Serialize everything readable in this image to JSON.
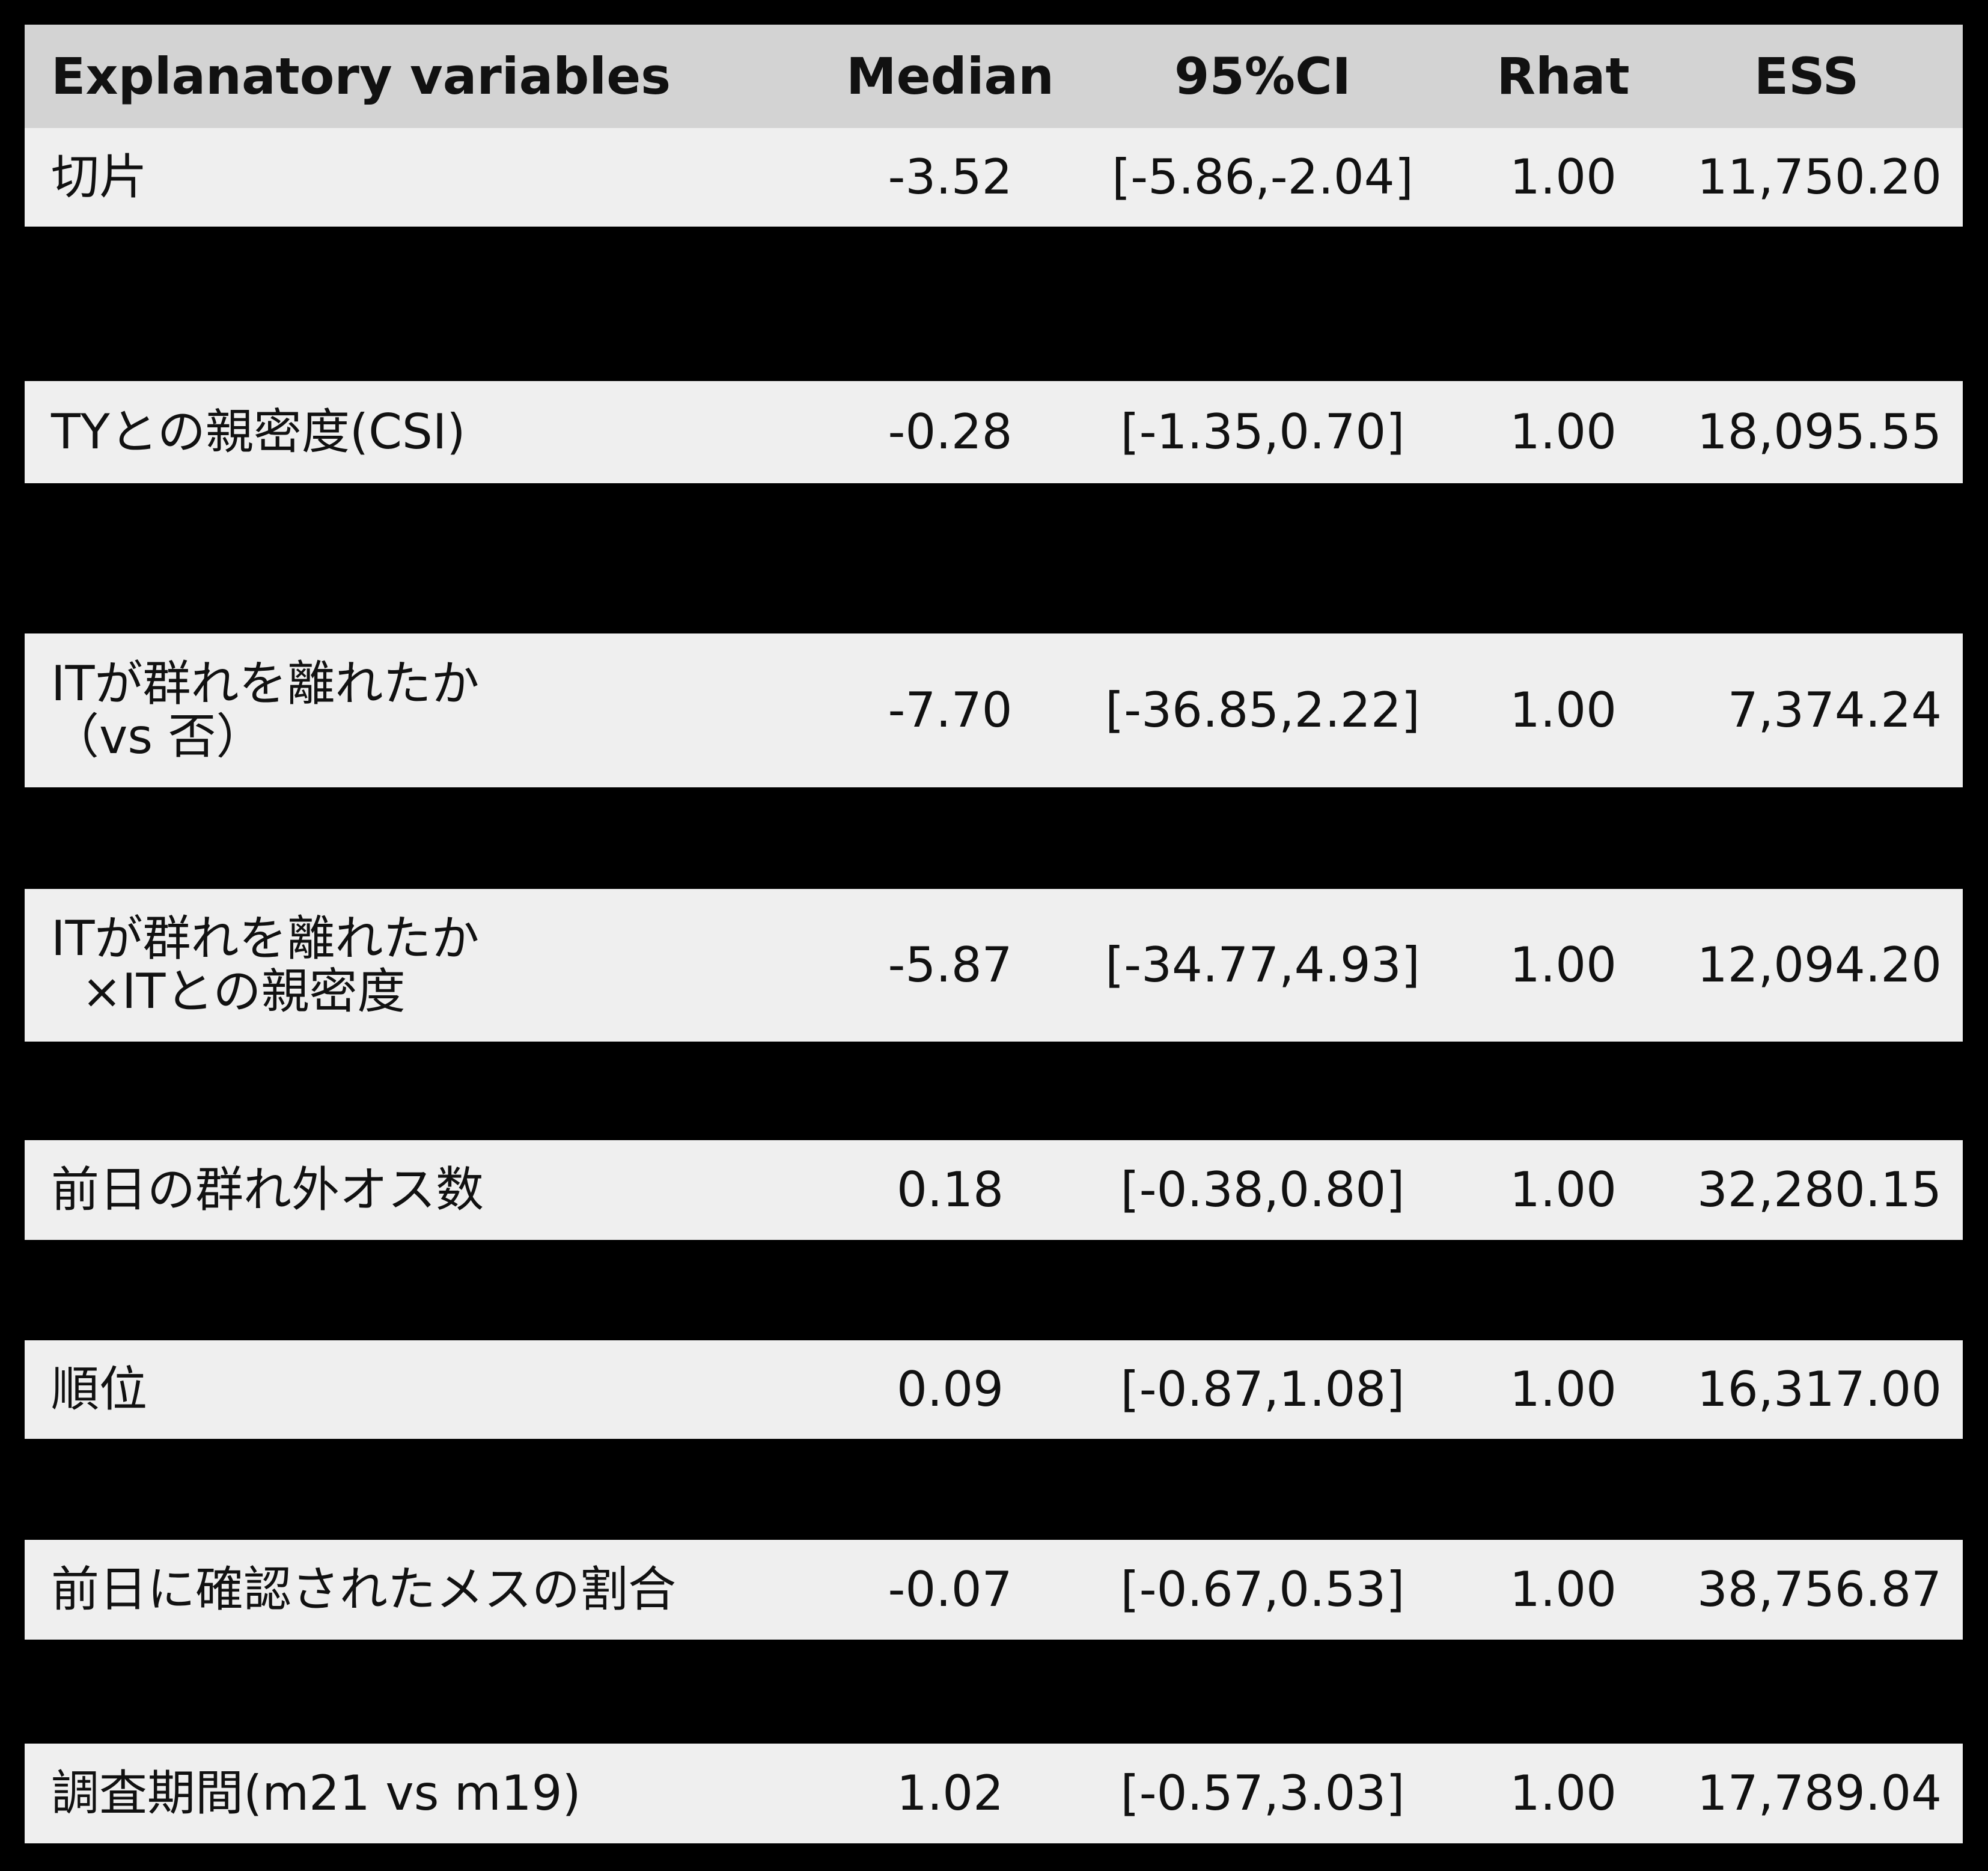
{
  "header": {
    "variable": "Explanatory variables",
    "median": "Median",
    "ci": "95%CI",
    "rhat": "Rhat",
    "ess": "ESS"
  },
  "rows": [
    {
      "variable": [
        "切片"
      ],
      "median": "-3.52",
      "ci": "[-5.86,-2.04]",
      "rhat": "1.00",
      "ess": "11,750.20"
    },
    {
      "variable": [
        "TYとの親密度(CSI)"
      ],
      "median": "-0.28",
      "ci": "[-1.35,0.70]",
      "rhat": "1.00",
      "ess": "18,095.55"
    },
    {
      "variable": [
        "ITが群れを離れたか",
        "（vs 否）"
      ],
      "median": "-7.70",
      "ci": "[-36.85,2.22]",
      "rhat": "1.00",
      "ess": "7,374.24"
    },
    {
      "variable": [
        "ITが群れを離れたか",
        "  ×ITとの親密度"
      ],
      "median": "-5.87",
      "ci": "[-34.77,4.93]",
      "rhat": "1.00",
      "ess": "12,094.20"
    },
    {
      "variable": [
        "前日の群れ外オス数"
      ],
      "median": "0.18",
      "ci": "[-0.38,0.80]",
      "rhat": "1.00",
      "ess": "32,280.15"
    },
    {
      "variable": [
        "順位"
      ],
      "median": "0.09",
      "ci": "[-0.87,1.08]",
      "rhat": "1.00",
      "ess": "16,317.00"
    },
    {
      "variable": [
        "前日に確認されたメスの割合"
      ],
      "median": "-0.07",
      "ci": "[-0.67,0.53]",
      "rhat": "1.00",
      "ess": "38,756.87"
    },
    {
      "variable": [
        "調査期間(m21 vs m19)"
      ],
      "median": "1.02",
      "ci": "[-0.57,3.03]",
      "rhat": "1.00",
      "ess": "17,789.04"
    }
  ]
}
